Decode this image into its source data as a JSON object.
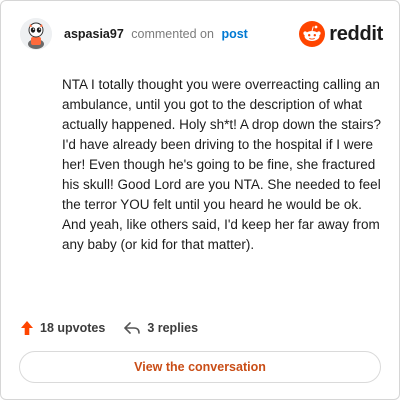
{
  "header": {
    "username": "aspasia97",
    "action_text": "commented on",
    "post_link": "post",
    "brand": "reddit"
  },
  "comment": {
    "text": "NTA I totally thought you were overreacting calling an ambulance, until you got to the description of what actually happened. Holy sh*t! A drop down the stairs? I'd have already been driving to the hospital if I were her! Even though he's going to be fine, she fractured his skull! Good Lord are you NTA. She needed to feel the terror YOU felt until you heard he would be ok. And yeah, like others said, I'd keep her far away from any baby (or kid for that matter)."
  },
  "actions": {
    "upvotes": "18 upvotes",
    "replies": "3 replies"
  },
  "footer": {
    "button_label": "View the conversation"
  },
  "colors": {
    "accent_orange": "#ff4500",
    "link_blue": "#0079d3",
    "button_text": "#c94d16"
  },
  "icons": {
    "avatar": "avatar-icon",
    "brand": "reddit-logo-icon",
    "upvote": "upvote-arrow-icon",
    "reply": "reply-arrow-icon"
  }
}
